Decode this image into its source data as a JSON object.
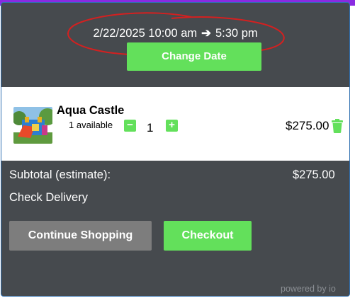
{
  "rental": {
    "start": "2/22/2025 10:00 am",
    "end": "5:30 pm",
    "change_date_label": "Change Date"
  },
  "cart": {
    "items": [
      {
        "name": "Aqua Castle",
        "availability": "1 available",
        "quantity": "1",
        "price": "$275.00",
        "minus_symbol": "−",
        "plus_symbol": "+",
        "thumbnail_icon": "bounce-house-photo"
      }
    ]
  },
  "summary": {
    "subtotal_label": "Subtotal (estimate):",
    "subtotal_value": "$275.00",
    "check_delivery_label": "Check Delivery"
  },
  "actions": {
    "continue_label": "Continue Shopping",
    "checkout_label": "Checkout"
  },
  "footer": {
    "powered_by": "powered by io"
  },
  "colors": {
    "panel_bg": "#464a4e",
    "accent_green": "#63e05b",
    "secondary_button": "#7d7d7d",
    "annotation_red": "#d42020"
  }
}
